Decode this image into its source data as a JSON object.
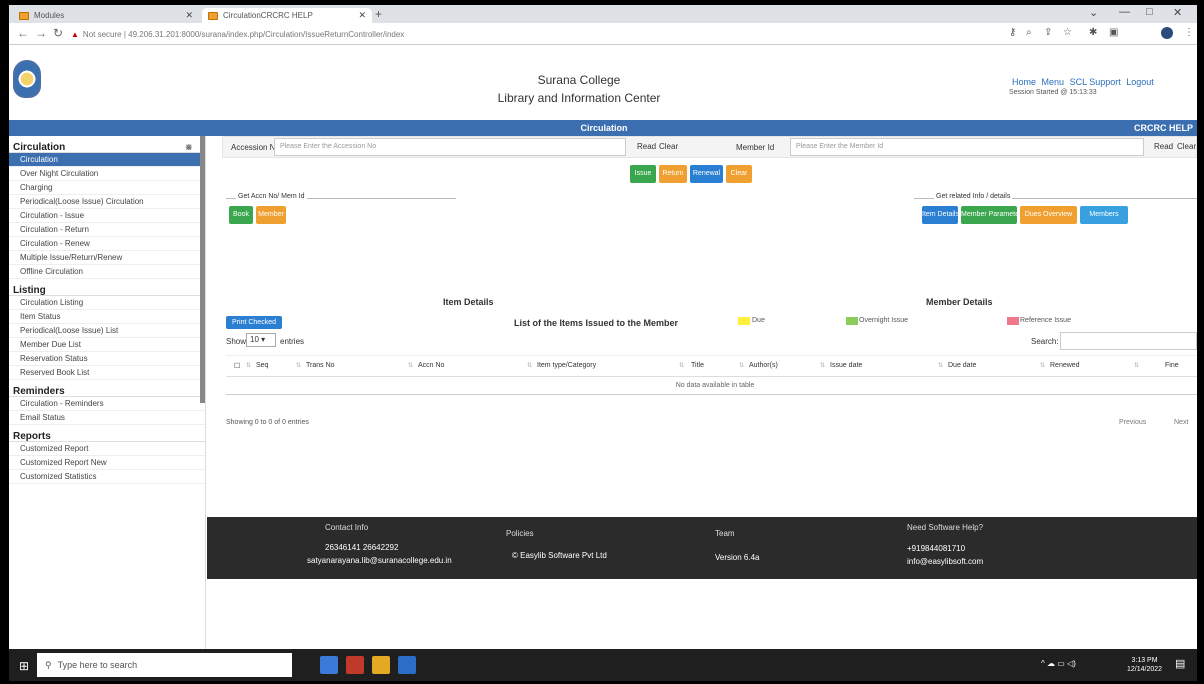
{
  "browser": {
    "tabs": [
      {
        "label": "Modules"
      },
      {
        "label": "CirculationCRCRC HELP"
      }
    ],
    "url": "Not secure | 49.206.31.201:8000/surana/index.php/Circulation/IssueReturnController/index"
  },
  "header": {
    "college": "Surana College",
    "center": "Library and Information Center",
    "links": [
      "Home",
      "Menu",
      "SCL Support",
      "Logout"
    ],
    "session": "Session Started @ 15:13:33"
  },
  "bluebar": {
    "center": "Circulation",
    "right": "CRCRC HELP"
  },
  "sidebar": {
    "sections": [
      {
        "title": "Circulation",
        "items": [
          "Circulation",
          "Over Night Circulation",
          "Charging",
          "Periodical(Loose Issue) Circulation",
          "Circulation - Issue",
          "Circulation - Return",
          "Circulation - Renew",
          "Multiple Issue/Return/Renew",
          "Offline Circulation"
        ]
      },
      {
        "title": "Listing",
        "items": [
          "Circulation Listing",
          "Item Status",
          "Periodical(Loose Issue) List",
          "Member Due List",
          "Reservation Status",
          "Reserved Book List"
        ]
      },
      {
        "title": "Reminders",
        "items": [
          "Circulation - Reminders",
          "Email Status"
        ]
      },
      {
        "title": "Reports",
        "items": [
          "Customized Report",
          "Customized Report New",
          "Customized Statistics"
        ]
      }
    ]
  },
  "main": {
    "accession_label": "Accession No",
    "accession_placeholder": "Please Enter the Accession No",
    "read1": "Read",
    "clear1": "Clear",
    "member_label": "Member Id",
    "member_placeholder": "Please Enter the Member Id",
    "read2": "Read",
    "clear2": "Clear",
    "action_buttons": [
      "Issue",
      "Return",
      "Renewal",
      "Clear"
    ],
    "get_accno_legend": "Get Accn No/ Mem Id",
    "get_accno_buttons": [
      "Book",
      "Member"
    ],
    "related_legend": "Get related Info / details",
    "related_buttons": [
      "Item Details",
      "Member Parameters",
      "Dues Overview",
      "Members"
    ],
    "item_details": "Item Details",
    "member_details": "Member Details",
    "print_btn": "Print Checked",
    "list_title": "List of the Items Issued to the Member",
    "legend_due": "Due",
    "legend_overnight": "Overnight Issue",
    "legend_reference": "Reference Issue",
    "show_label": "Show",
    "entries_value": "10",
    "entries_label": "entries",
    "search_label": "Search:",
    "columns": [
      "Seq",
      "Trans No",
      "Accn No",
      "Item type/Category",
      "Title",
      "Author(s)",
      "Issue date",
      "Due date",
      "Renewed",
      "Fine"
    ],
    "no_data": "No data available in table",
    "showing": "Showing 0 to 0 of 0 entries",
    "previous": "Previous",
    "next": "Next"
  },
  "footer": {
    "contact_h": "Contact Info",
    "phones": "26346141 26642292",
    "email": "satyanarayana.lib@suranacollege.edu.in",
    "policies_h": "Policies",
    "copyright": "© Easylib Software Pvt Ltd",
    "team_h": "Team",
    "version": "Version 6.4a",
    "help_h": "Need Software Help?",
    "help_phone": "+919844081710",
    "help_email": "info@easylibsoft.com"
  },
  "taskbar": {
    "search_placeholder": "Type here to search",
    "time": "3:13 PM",
    "date": "12/14/2022"
  }
}
